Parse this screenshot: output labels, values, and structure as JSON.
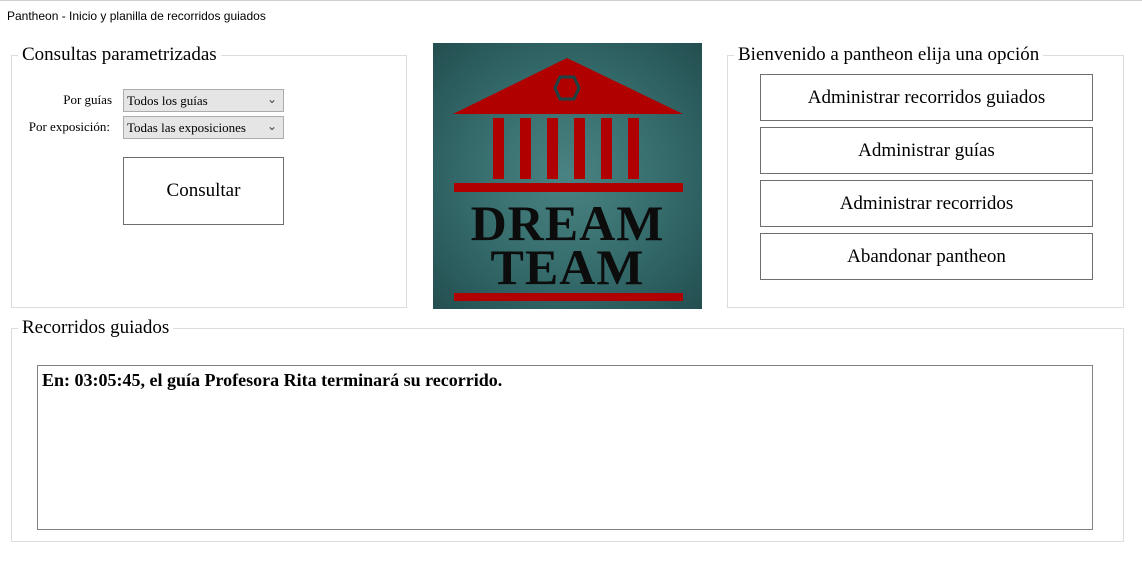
{
  "window": {
    "title": "Pantheon - Inicio y planilla de recorridos guiados"
  },
  "consultas": {
    "title": "Consultas parametrizadas",
    "guias_label": "Por guías",
    "guias_value": "Todos los guías",
    "exposicion_label": "Por exposición:",
    "exposicion_value": "Todas las exposiciones",
    "consultar_button": "Consultar"
  },
  "logo": {
    "line1": "DREAM",
    "line2": "TEAM",
    "icon": "pantheon-building-icon",
    "colors": {
      "background": "#346a6a",
      "red": "#b00000",
      "text": "#0c0c0c"
    }
  },
  "menu": {
    "title": "Bienvenido a pantheon elija una opción",
    "buttons": [
      "Administrar recorridos guiados",
      "Administrar guías",
      "Administrar recorridos",
      "Abandonar pantheon"
    ]
  },
  "recorridos": {
    "title": "Recorridos guiados",
    "log": "En: 03:05:45, el guía Profesora Rita terminará su recorrido."
  }
}
